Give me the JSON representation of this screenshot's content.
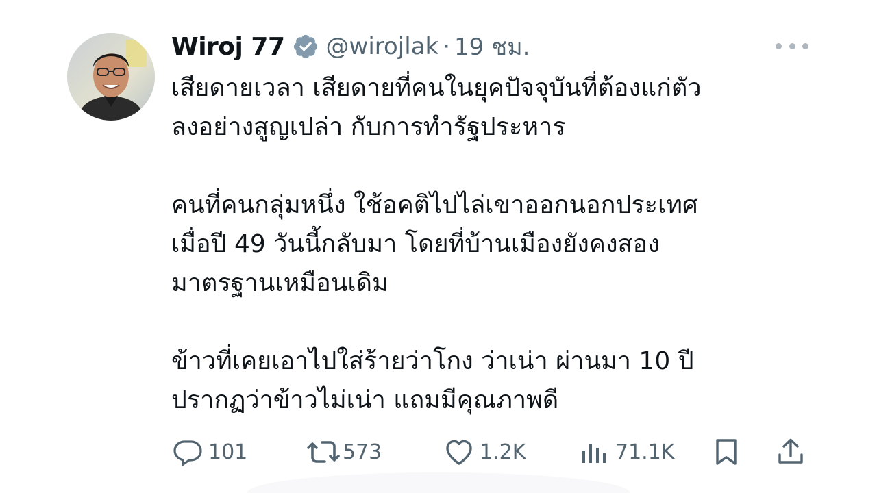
{
  "author": {
    "display_name": "Wiroj 77",
    "handle": "@wirojlak",
    "separator": "·",
    "time": "19 ชม.",
    "verified_icon": "verified-badge-icon"
  },
  "tweet": {
    "paragraphs": [
      {
        "lines": [
          "เสียดายเวลา เสียดายที่คนในยุคปัจจุบันที่ต้องแก่ตัว",
          "ลงอย่างสูญเปล่า กับการทำรัฐประหาร"
        ]
      },
      {
        "lines": [
          "คนที่คนกลุ่มหนึ่ง ใช้อคติไปไล่เขาออกนอกประเทศ",
          "เมื่อปี 49 วันนี้กลับมา โดยที่บ้านเมืองยังคงสอง",
          "มาตรฐานเหมือนเดิม"
        ]
      },
      {
        "lines": [
          "ข้าวที่เคยเอาไปใส่ร้ายว่าโกง ว่าเน่า ผ่านมา 10 ปี",
          "ปรากฏว่าข้าวไม่เน่า แถมมีคุณภาพดี"
        ]
      }
    ]
  },
  "actions": {
    "reply": {
      "icon": "reply-icon",
      "count": "101"
    },
    "retweet": {
      "icon": "retweet-icon",
      "count": "573"
    },
    "like": {
      "icon": "heart-icon",
      "count": "1.2K"
    },
    "views": {
      "icon": "views-icon",
      "count": "71.1K"
    },
    "bookmark": {
      "icon": "bookmark-icon"
    },
    "share": {
      "icon": "share-icon"
    }
  },
  "colors": {
    "text_primary": "#0f1419",
    "text_secondary": "#536471",
    "verified_badge": "#829aab"
  }
}
